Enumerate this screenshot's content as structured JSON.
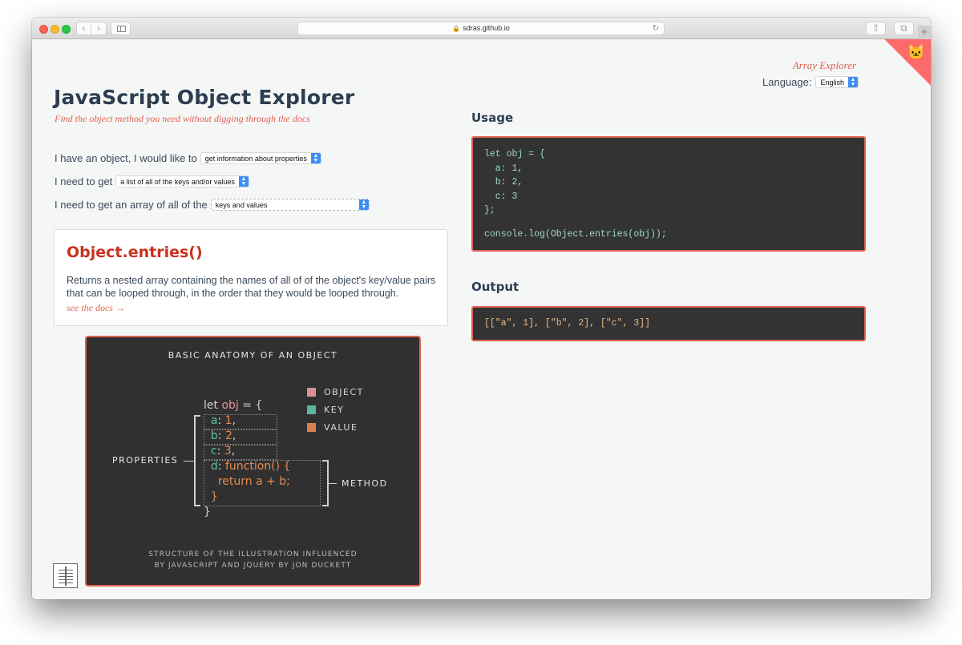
{
  "browser": {
    "url": "sdras.github.io",
    "icons": [
      "back-icon",
      "forward-icon",
      "sidebar-icon",
      "lock-icon",
      "reload-icon",
      "share-icon",
      "tabs-icon",
      "new-tab-icon"
    ]
  },
  "header": {
    "array_explorer_link": "Array Explorer",
    "language_label": "Language:",
    "language_value": "English"
  },
  "main": {
    "title": "JavaScript Object Explorer",
    "subtitle": "Find the object method you need without digging through the docs",
    "questions": [
      {
        "label": "I have an object, I would like to",
        "value": "get information about properties"
      },
      {
        "label": "I need to get",
        "value": "a list of all of the keys and/or values"
      },
      {
        "label": "I need to get an array of all of the",
        "value": "keys and values"
      }
    ],
    "method": {
      "name": "Object.entries()",
      "description": "Returns a nested array containing the names of all of of the object's key/value pairs that can be looped through, in the order that they would be looped through.",
      "docs_link": "see the docs →"
    }
  },
  "anatomy": {
    "title": "BASIC ANATOMY OF AN OBJECT",
    "legend": [
      {
        "label": "OBJECT",
        "color": "#d8909a"
      },
      {
        "label": "KEY",
        "color": "#5bb8a0"
      },
      {
        "label": "VALUE",
        "color": "#d9804f"
      }
    ],
    "code": {
      "l0_kw": "let ",
      "l0_obj": "obj",
      "l0_rest": " = {",
      "l1_key": "a",
      "l1_val": "1",
      "l2_key": "b",
      "l2_val": "2",
      "l3_key": "c",
      "l3_val": "3",
      "l4_key": "d",
      "l4_val": "function() {",
      "l5_val": "return a + b;",
      "l6_val": "}",
      "l7": "}"
    },
    "properties_label": "PROPERTIES",
    "method_label": "METHOD",
    "credit_line1": "STRUCTURE OF THE ILLUSTRATION INFLUENCED",
    "credit_line2": "BY JAVASCRIPT AND JQUERY BY JON DUCKETT"
  },
  "usage": {
    "heading": "Usage",
    "lines": [
      "let obj = {",
      "  a: 1,",
      "  b: 2,",
      "  c: 3",
      "};",
      "",
      "console.log(Object.entries(obj));"
    ]
  },
  "output": {
    "heading": "Output",
    "value": "[[\"a\", 1], [\"b\", 2], [\"c\", 3]]"
  },
  "colors": {
    "accent": "#e0624f",
    "heading": "#2c3e50",
    "method_name": "#c8321f",
    "corner_banner": "#fc6a6a"
  }
}
